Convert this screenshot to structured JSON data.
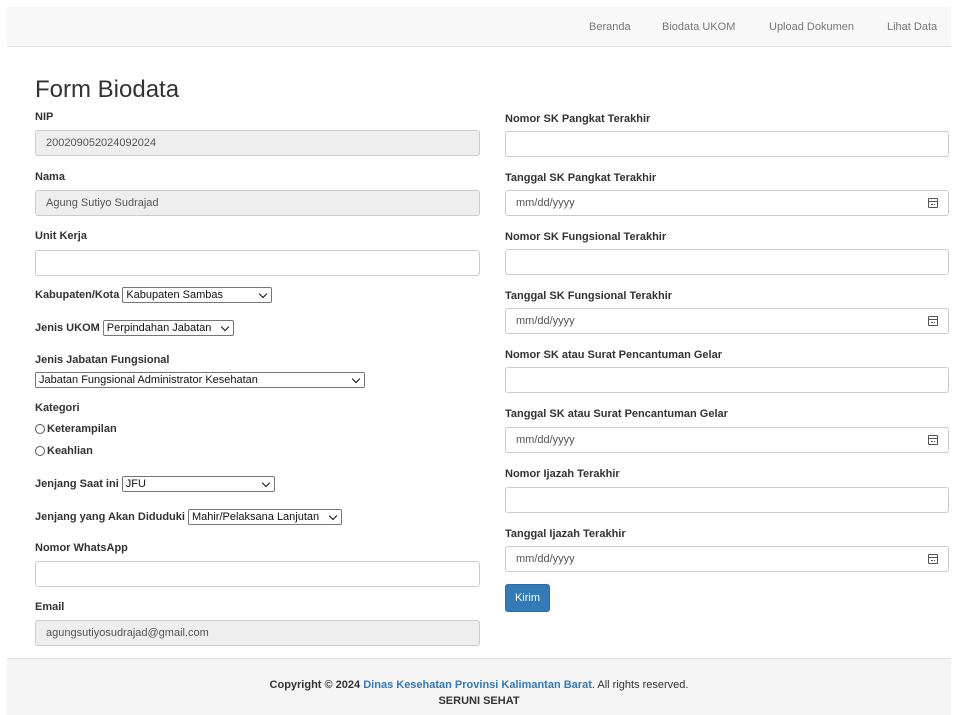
{
  "nav": {
    "items": [
      "Beranda",
      "Biodata UKOM",
      "Upload Dokumen",
      "Lihat Data"
    ]
  },
  "form": {
    "title": "Form Biodata",
    "nip": {
      "label": "NIP",
      "value": "200209052024092024"
    },
    "nama": {
      "label": "Nama",
      "value": "Agung Sutiyo Sudrajad"
    },
    "unit_kerja": {
      "label": "Unit Kerja",
      "value": ""
    },
    "kabupaten": {
      "label": "Kabupaten/Kota",
      "selected": "Kabupaten Sambas"
    },
    "jenis_ukom": {
      "label": "Jenis UKOM",
      "selected": "Perpindahan Jabatan"
    },
    "jenis_jabatan": {
      "label": "Jenis Jabatan Fungsional",
      "selected": "Jabatan Fungsional Administrator Kesehatan"
    },
    "kategori": {
      "label": "Kategori",
      "options": [
        "Keterampilan",
        "Keahlian"
      ]
    },
    "jenjang_saat_ini": {
      "label": "Jenjang Saat ini",
      "selected": "JFU"
    },
    "jenjang_akan": {
      "label": "Jenjang yang Akan Diduduki",
      "selected": "Mahir/Pelaksana Lanjutan"
    },
    "whatsapp": {
      "label": "Nomor WhatsApp",
      "value": ""
    },
    "email": {
      "label": "Email",
      "value": "agungsutiyosudrajad@gmail.com"
    },
    "sk_pangkat": {
      "label": "Nomor SK Pangkat Terakhir",
      "value": ""
    },
    "tgl_sk_pangkat": {
      "label": "Tanggal SK Pangkat Terakhir",
      "placeholder": "mm/dd/yyyy"
    },
    "sk_fungsional": {
      "label": "Nomor SK Fungsional Terakhir",
      "value": ""
    },
    "tgl_sk_fungsional": {
      "label": "Tanggal SK Fungsional Terakhir",
      "placeholder": "mm/dd/yyyy"
    },
    "sk_gelar": {
      "label": "Nomor SK atau Surat Pencantuman Gelar",
      "value": ""
    },
    "tgl_sk_gelar": {
      "label": "Tanggal SK atau Surat Pencantuman Gelar",
      "placeholder": "mm/dd/yyyy"
    },
    "ijazah": {
      "label": "Nomor Ijazah Terakhir",
      "value": ""
    },
    "tgl_ijazah": {
      "label": "Tanggal Ijazah Terakhir",
      "placeholder": "mm/dd/yyyy"
    },
    "submit_label": "Kirim"
  },
  "footer": {
    "copyright_prefix": "Copyright © 2024",
    "org_link": "Dinas Kesehatan Provinsi Kalimantan Barat",
    "suffix": ". All rights reserved.",
    "tagline": "SERUNI SEHAT"
  },
  "colors": {
    "primary": "#337ab7",
    "navbar_bg": "#f8f8f8",
    "readonly_bg": "#eeeeee"
  }
}
